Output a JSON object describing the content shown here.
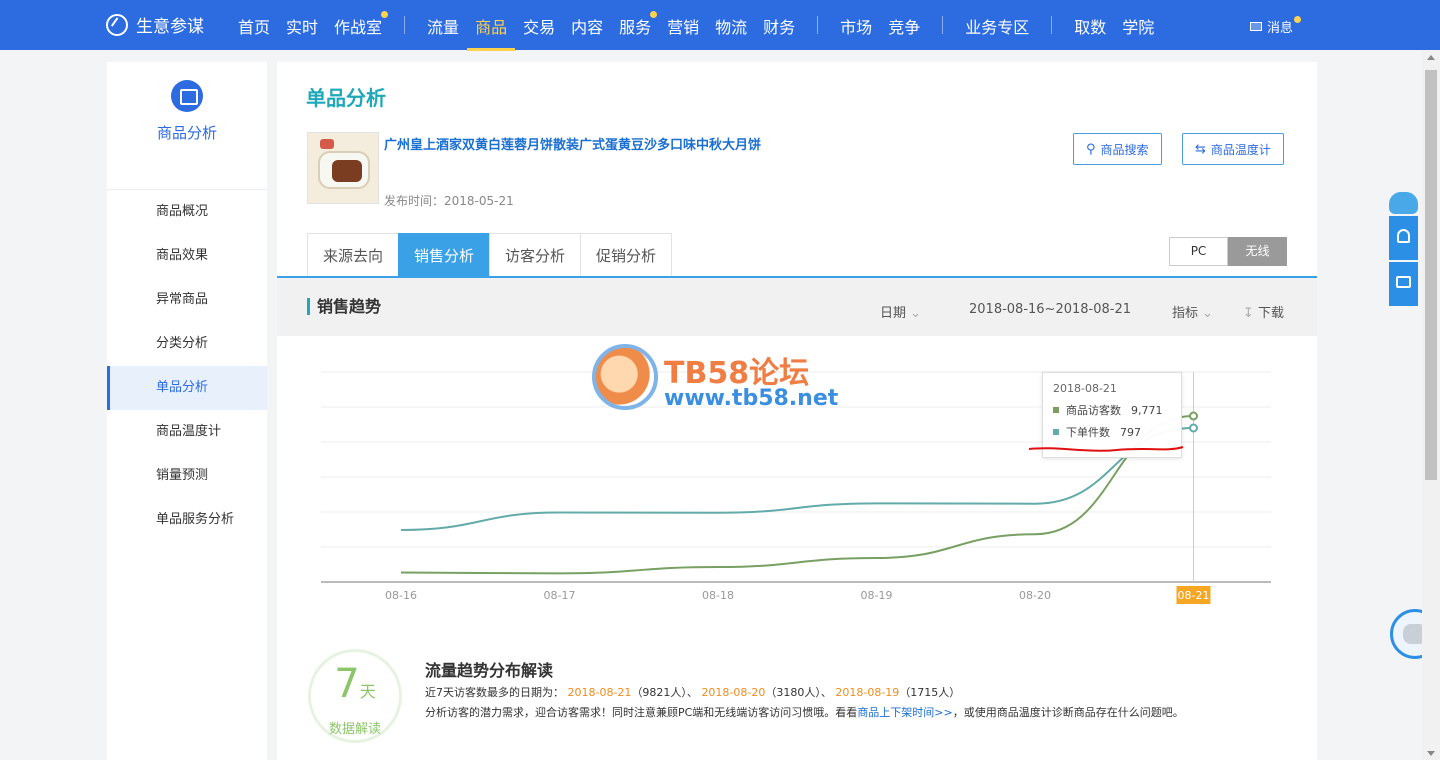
{
  "topnav": {
    "brand": "生意参谋",
    "groups": [
      [
        {
          "label": "首页"
        },
        {
          "label": "实时"
        },
        {
          "label": "作战室"
        }
      ],
      [
        {
          "label": "流量"
        },
        {
          "label": "商品"
        },
        {
          "label": "交易"
        },
        {
          "label": "内容"
        },
        {
          "label": "服务"
        },
        {
          "label": "营销"
        },
        {
          "label": "物流"
        },
        {
          "label": "财务"
        }
      ],
      [
        {
          "label": "市场"
        },
        {
          "label": "竞争"
        }
      ],
      [
        {
          "label": "业务专区"
        }
      ],
      [
        {
          "label": "取数"
        },
        {
          "label": "学院"
        }
      ]
    ],
    "active": "商品",
    "message": "消息"
  },
  "sidebar": {
    "title": "商品分析",
    "items": [
      {
        "label": "商品概况"
      },
      {
        "label": "商品效果"
      },
      {
        "label": "异常商品"
      },
      {
        "label": "分类分析"
      },
      {
        "label": "单品分析"
      },
      {
        "label": "商品温度计"
      },
      {
        "label": "销量预测"
      },
      {
        "label": "单品服务分析"
      }
    ],
    "active": "单品分析"
  },
  "page": {
    "title": "单品分析",
    "product_name": "广州皇上酒家双黄白莲蓉月饼散装广式蛋黄豆沙多口味中秋大月饼",
    "publish_date": "发布时间：2018-05-21",
    "search_button": "商品搜索",
    "thermo_button": "商品温度计"
  },
  "tabs": [
    {
      "label": "来源去向"
    },
    {
      "label": "销售分析"
    },
    {
      "label": "访客分析"
    },
    {
      "label": "促销分析"
    }
  ],
  "active_tab": "销售分析",
  "device": {
    "pc": "PC",
    "wireless": "无线",
    "active": "无线"
  },
  "trend": {
    "title": "销售趋势",
    "date_label": "日期",
    "date_range": "2018-08-16~2018-08-21",
    "metric_label": "指标",
    "download_label": "下载"
  },
  "watermark": {
    "line1": "TB58论坛",
    "line2": "www.tb58.net"
  },
  "chart_data": {
    "type": "line",
    "x": [
      "08-16",
      "08-17",
      "08-18",
      "08-19",
      "08-20",
      "08-21"
    ],
    "highlight_x": "08-21",
    "series": [
      {
        "name": "商品访客数",
        "color": "#78a062",
        "values": [
          210,
          160,
          550,
          1100,
          2550,
          9771
        ]
      },
      {
        "name": "下单件数",
        "color": "#63aaaa",
        "values": [
          300,
          385,
          384,
          430,
          428,
          797
        ]
      }
    ],
    "tooltip": {
      "date": "2018-08-21",
      "rows": [
        {
          "name": "商品访客数",
          "value": "9,771",
          "color": "#78a062"
        },
        {
          "name": "下单件数",
          "value": "797",
          "color": "#63aaaa"
        }
      ]
    }
  },
  "interpretation": {
    "num": "7",
    "unit": "天",
    "label": "数据解读",
    "title": "流量趋势分布解读",
    "line1_prefix": "近7天访客数最多的日期为：",
    "top_dates": [
      {
        "date": "2018-08-21",
        "count": "（9821人）、"
      },
      {
        "date": "2018-08-20",
        "count": "（3180人）、"
      },
      {
        "date": "2018-08-19",
        "count": "（1715人）"
      }
    ],
    "line2_text": "分析访客的潜力需求，迎合访客需求！同时注意兼顾PC端和无线端访客访问习惯哦。看看",
    "line2_link": "商品上下架时间>>",
    "line2_suffix": "，或使用商品温度计诊断商品存在什么问题吧。"
  }
}
